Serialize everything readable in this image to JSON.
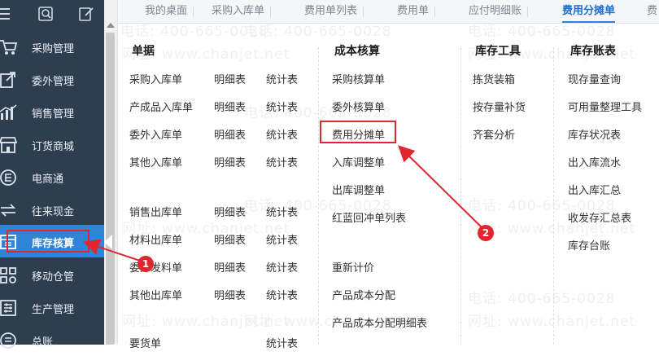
{
  "sidebar": {
    "items": [
      {
        "label": "采购管理",
        "icon": "cart-icon"
      },
      {
        "label": "委外管理",
        "icon": "export-doc-icon"
      },
      {
        "label": "销售管理",
        "icon": "bar-chart-icon"
      },
      {
        "label": "订货商城",
        "icon": "store-icon"
      },
      {
        "label": "电商通",
        "icon": "ecommerce-icon"
      },
      {
        "label": "往来现金",
        "icon": "exchange-icon"
      },
      {
        "label": "库存核算",
        "icon": "inventory-icon",
        "active": true
      },
      {
        "label": "移动仓管",
        "icon": "grid-icon"
      },
      {
        "label": "生产管理",
        "icon": "sliders-icon"
      },
      {
        "label": "总账",
        "icon": "ledger-icon"
      }
    ]
  },
  "tabs": [
    {
      "label": "我的桌面"
    },
    {
      "label": "采购入库单"
    },
    {
      "label": "费用单列表"
    },
    {
      "label": "费用单"
    },
    {
      "label": "应付明细账"
    },
    {
      "label": "费用分摊单",
      "active": true
    },
    {
      "label": "费"
    }
  ],
  "menu": {
    "col1": {
      "header": "单据",
      "rows": [
        [
          "采购入库单",
          "明细表",
          "统计表"
        ],
        [
          "产成品入库单",
          "明细表",
          "统计表"
        ],
        [
          "委外入库单",
          "明细表",
          "统计表"
        ],
        [
          "其他入库单",
          "明细表",
          "统计表"
        ],
        [
          "销售出库单",
          "明细表",
          "统计表"
        ],
        [
          "材料出库单",
          "明细表",
          "统计表"
        ],
        [
          "委外发料单",
          "明细表",
          "统计表"
        ],
        [
          "其他出库单",
          "明细表",
          "统计表"
        ],
        [
          "要货单",
          "",
          "统计表"
        ]
      ]
    },
    "col2": {
      "header": "成本核算",
      "items": [
        "采购核算单",
        "委外核算单",
        "费用分摊单",
        "入库调整单",
        "出库调整单",
        "红蓝回冲单列表",
        "重新计价",
        "产品成本分配",
        "产品成本分配明细表"
      ]
    },
    "col3": {
      "header": "库存工具",
      "items": [
        "拣货装箱",
        "按存量补货",
        "齐套分析"
      ]
    },
    "col4": {
      "header": "库存账表",
      "items": [
        "现存量查询",
        "可用量整理工具",
        "库存状况表",
        "出入库流水",
        "出入库汇总",
        "收发存汇总表",
        "库存台账"
      ]
    }
  },
  "annotations": {
    "badge1": "1",
    "badge2": "2"
  },
  "watermark": {
    "phone": "电话: 400-665-0028",
    "site": "网址: www.chanjet.net"
  },
  "colors": {
    "sidebar_bg": "#2f3e4e",
    "active_bg": "#2e85d8",
    "annotation": "#e0262e"
  }
}
